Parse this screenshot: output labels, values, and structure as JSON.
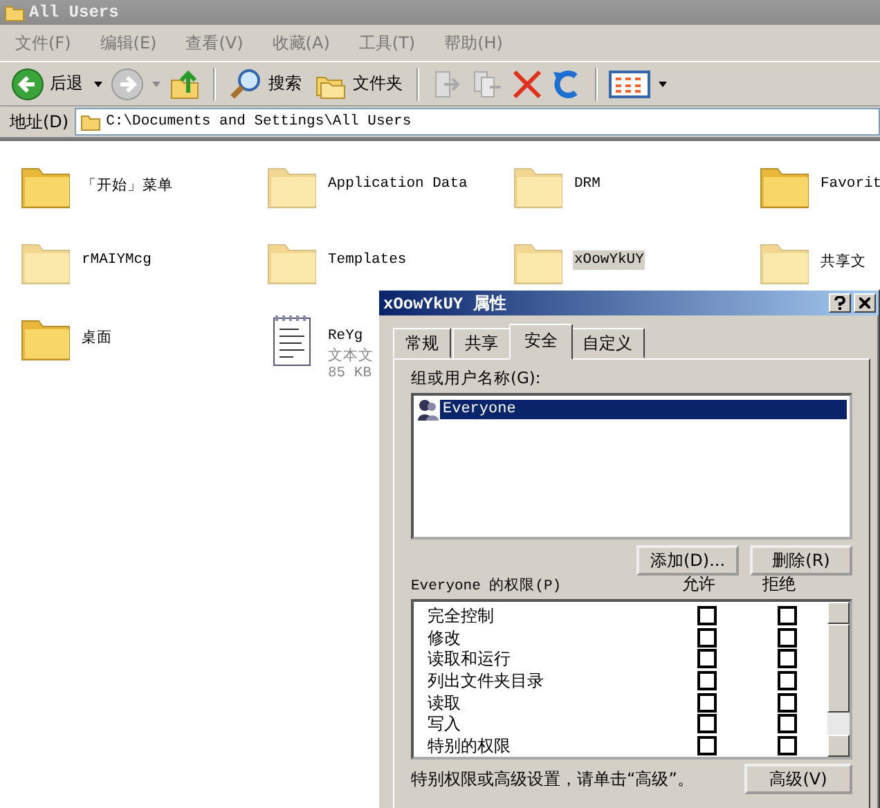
{
  "window": {
    "title": "All Users"
  },
  "menu": [
    "文件(F)",
    "编辑(E)",
    "查看(V)",
    "收藏(A)",
    "工具(T)",
    "帮助(H)"
  ],
  "toolbar": {
    "back": "后退",
    "search": "搜索",
    "folders": "文件夹"
  },
  "address": {
    "label": "地址(D)",
    "value": "C:\\Documents and Settings\\All Users"
  },
  "files": [
    {
      "kind": "folder",
      "name": "「开始」菜单",
      "hidden": false,
      "selected": false
    },
    {
      "kind": "folder",
      "name": "Application Data",
      "hidden": true,
      "selected": false
    },
    {
      "kind": "folder",
      "name": "DRM",
      "hidden": true,
      "selected": false
    },
    {
      "kind": "folder",
      "name": "Favorit",
      "hidden": false,
      "selected": false
    },
    {
      "kind": "folder",
      "name": "rMAIYMcg",
      "hidden": true,
      "selected": false
    },
    {
      "kind": "folder",
      "name": "Templates",
      "hidden": true,
      "selected": false
    },
    {
      "kind": "folder",
      "name": "xOowYkUY",
      "hidden": true,
      "selected": true
    },
    {
      "kind": "folder",
      "name": "共享文",
      "hidden": true,
      "selected": false
    },
    {
      "kind": "folder",
      "name": "桌面",
      "hidden": false,
      "selected": false
    },
    {
      "kind": "textfile",
      "name": "ReYg",
      "type": "文本文",
      "size": "85 KB",
      "hidden": false,
      "selected": false
    }
  ],
  "dialog": {
    "title": "xOowYkUY 属性",
    "tabs": [
      {
        "label": "常规",
        "selected": false
      },
      {
        "label": "共享",
        "selected": false
      },
      {
        "label": "安全",
        "selected": true
      },
      {
        "label": "自定义",
        "selected": false
      }
    ],
    "users_label": "组或用户名称(G):",
    "users": [
      {
        "name": "Everyone",
        "selected": true
      }
    ],
    "buttons": [
      "添加(D)...",
      "删除(R)"
    ],
    "permissions_label": "Everyone 的权限(P)",
    "columns": [
      "允许",
      "拒绝"
    ],
    "permissions": [
      {
        "name": "完全控制",
        "allow": false,
        "deny": false
      },
      {
        "name": "修改",
        "allow": false,
        "deny": false
      },
      {
        "name": "读取和运行",
        "allow": false,
        "deny": false
      },
      {
        "name": "列出文件夹目录",
        "allow": false,
        "deny": false
      },
      {
        "name": "读取",
        "allow": false,
        "deny": false
      },
      {
        "name": "写入",
        "allow": false,
        "deny": false
      },
      {
        "name": "特别的权限",
        "allow": false,
        "deny": false
      }
    ],
    "advanced_hint": "特别权限或高级设置，请单击“高级”。",
    "advanced_button": "高级(V)"
  }
}
